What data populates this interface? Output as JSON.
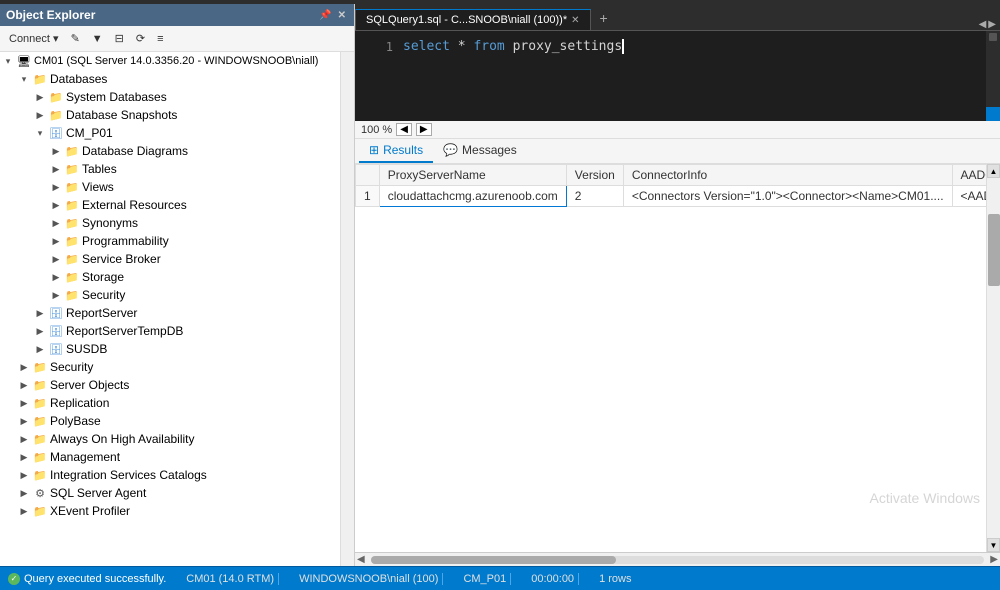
{
  "oe_title": "Object Explorer",
  "oe_header_pins": [
    "▸",
    "✕"
  ],
  "toolbar": {
    "connect_label": "Connect ▾",
    "buttons": [
      "👤",
      "✕",
      "▼",
      "⟳",
      "≡"
    ]
  },
  "tree": {
    "root": {
      "label": "CM01 (SQL Server 14.0.3356.20 - WINDOWSNOOB\\niall)",
      "expanded": true,
      "children": [
        {
          "label": "Databases",
          "expanded": true,
          "children": [
            {
              "label": "System Databases",
              "expanded": false
            },
            {
              "label": "Database Snapshots",
              "expanded": false
            },
            {
              "label": "CM_P01",
              "expanded": true,
              "children": [
                {
                  "label": "Database Diagrams",
                  "expanded": false
                },
                {
                  "label": "Tables",
                  "expanded": false
                },
                {
                  "label": "Views",
                  "expanded": false
                },
                {
                  "label": "External Resources",
                  "expanded": false
                },
                {
                  "label": "Synonyms",
                  "expanded": false
                },
                {
                  "label": "Programmability",
                  "expanded": false
                },
                {
                  "label": "Service Broker",
                  "expanded": false
                },
                {
                  "label": "Storage",
                  "expanded": false
                },
                {
                  "label": "Security",
                  "expanded": false
                }
              ]
            },
            {
              "label": "ReportServer",
              "expanded": false
            },
            {
              "label": "ReportServerTempDB",
              "expanded": false
            },
            {
              "label": "SUSDB",
              "expanded": false
            }
          ]
        },
        {
          "label": "Security",
          "expanded": false
        },
        {
          "label": "Server Objects",
          "expanded": false
        },
        {
          "label": "Replication",
          "expanded": false
        },
        {
          "label": "PolyBase",
          "expanded": false
        },
        {
          "label": "Always On High Availability",
          "expanded": false
        },
        {
          "label": "Management",
          "expanded": false
        },
        {
          "label": "Integration Services Catalogs",
          "expanded": false
        },
        {
          "label": "SQL Server Agent",
          "expanded": false
        },
        {
          "label": "XEvent Profiler",
          "expanded": false
        }
      ]
    }
  },
  "tab": {
    "label": "SQLQuery1.sql - C...SNOOB\\niall (100))*",
    "close": "✕",
    "tab_icon": "+"
  },
  "editor": {
    "line1_num": "1",
    "line1_content": "select * from proxy_settings"
  },
  "zoom": {
    "level": "100 %",
    "btn_minus": "◀",
    "btn_plus": "▶"
  },
  "results_tabs": [
    {
      "label": "Results",
      "icon": "⊞",
      "active": true
    },
    {
      "label": "Messages",
      "icon": "💬",
      "active": false
    }
  ],
  "results": {
    "columns": [
      "",
      "ProxyServerName",
      "Version",
      "ConnectorInfo",
      "AADConfig"
    ],
    "rows": [
      {
        "row_num": "1",
        "ProxyServerName": "cloudattachcmg.azurenoob.com",
        "Version": "2",
        "ConnectorInfo": "<Connectors Version=\"1.0\"><Connector><Name>CM01....",
        "AADConfig": "<AADConfig Versio..."
      }
    ]
  },
  "status": {
    "success_text": "Query executed successfully.",
    "server": "CM01 (14.0 RTM)",
    "user": "WINDOWSNOOB\\niall (100)",
    "db": "CM_P01",
    "time": "00:00:00",
    "rows": "1 rows"
  },
  "watermark": "Activate Windows"
}
